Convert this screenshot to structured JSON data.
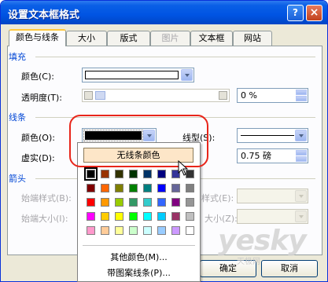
{
  "window": {
    "title": "设置文本框格式"
  },
  "titlebar_buttons": {
    "help": "?",
    "close": "×"
  },
  "tabs": [
    {
      "label": "颜色与线条",
      "active": true
    },
    {
      "label": "大小"
    },
    {
      "label": "版式"
    },
    {
      "label": "图片",
      "disabled": true
    },
    {
      "label": "文本框"
    },
    {
      "label": "网站"
    }
  ],
  "fill": {
    "section_label": "填充",
    "color_label": "颜色(C):",
    "color_value": "#ffffff",
    "transparency_label": "透明度(T):",
    "transparency_value": "0 %"
  },
  "line": {
    "section_label": "线条",
    "color_label": "颜色(O):",
    "color_value": "#000000",
    "style_label": "线型(S):",
    "dash_label": "虚实(D):",
    "weight_value": "0.75 磅"
  },
  "arrows": {
    "section_label": "箭头",
    "begin_style_label": "始端样式(B):",
    "begin_size_label": "始端大小(I):",
    "end_style_label_partial": "样式(E):",
    "end_size_label_partial": "大小(Z):"
  },
  "color_popup": {
    "no_line": "无线条颜色",
    "more_colors": "其他颜色(M)...",
    "patterned_lines": "带图案线条(P)...",
    "palette": [
      [
        "#000000",
        "#993300",
        "#333300",
        "#003300",
        "#003366",
        "#000080",
        "#333399",
        "#333333"
      ],
      [
        "#800000",
        "#ff6600",
        "#808000",
        "#008000",
        "#008080",
        "#0000ff",
        "#666699",
        "#808080"
      ],
      [
        "#ff0000",
        "#ff9900",
        "#99cc00",
        "#339966",
        "#33cccc",
        "#3366ff",
        "#800080",
        "#969696"
      ],
      [
        "#ff00ff",
        "#ffcc00",
        "#ffff00",
        "#00ff00",
        "#00ffff",
        "#00ccff",
        "#993366",
        "#c0c0c0"
      ],
      [
        "#ff99cc",
        "#ffcc99",
        "#ffff99",
        "#ccffcc",
        "#ccffff",
        "#99ccff",
        "#cc99ff",
        "#ffffff"
      ]
    ],
    "selected": [
      0,
      0
    ]
  },
  "buttons": {
    "ok": "确定",
    "cancel": "取消"
  },
  "watermark": {
    "brand": "yesky",
    "sub": "天极网"
  },
  "colors": {
    "accent": "#0046d5",
    "title_bar": "#0054e3",
    "highlight": "#e8251a"
  }
}
